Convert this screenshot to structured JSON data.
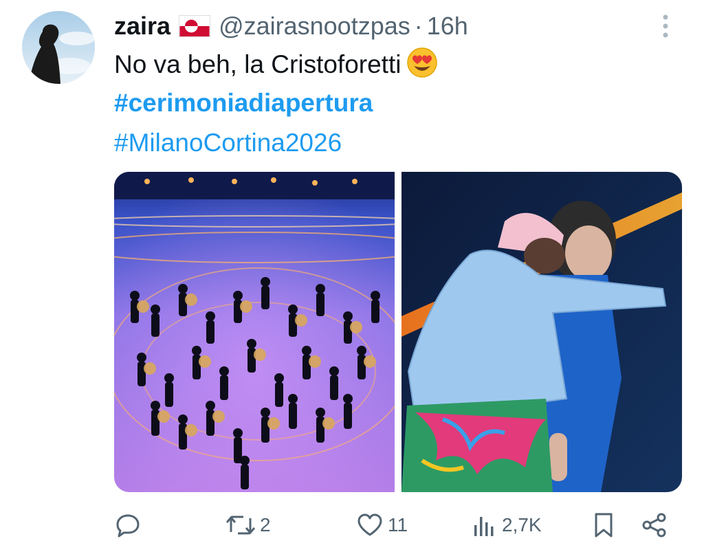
{
  "tweet": {
    "display_name": "zaira",
    "flag_icon": "greenland-flag-icon",
    "handle": "@zairasnootzpas",
    "separator": "·",
    "time": "16h",
    "text_line1": "No va beh, la Cristoforetti",
    "emoji_icon": "heart-eyes-emoji-icon",
    "hashtag1": "#cerimoniadiapertura",
    "hashtag2": "#MilanoCortina2026"
  },
  "media": {
    "left_image": "opening-ceremony-performers-image",
    "right_image": "two-people-on-stage-image"
  },
  "actions": {
    "reply_count": "",
    "retweet_count": "2",
    "like_count": "11",
    "views_count": "2,7K"
  },
  "colors": {
    "accent": "#1d9bf0",
    "secondary_text": "#536471",
    "primary_text": "#0f1419"
  }
}
